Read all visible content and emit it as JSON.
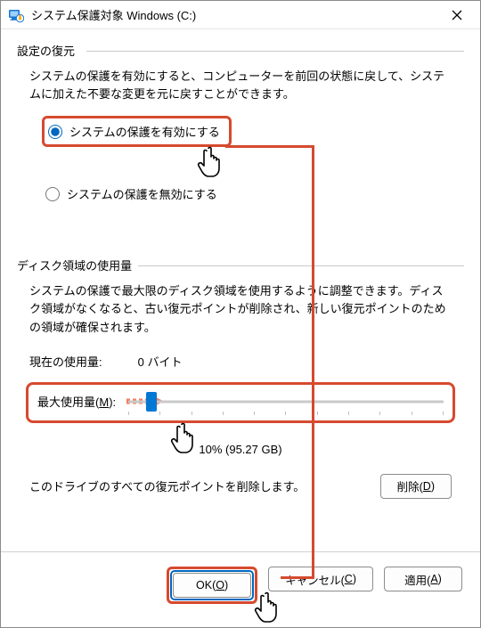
{
  "title": "システム保護対象 Windows (C:)",
  "restore": {
    "heading": "設定の復元",
    "desc": "システムの保護を有効にすると、コンピューターを前回の状態に戻して、システムに加えた不要な変更を元に戻すことができます。",
    "radios": {
      "enable": "システムの保護を有効にする",
      "disable": "システムの保護を無効にする"
    }
  },
  "disk": {
    "heading": "ディスク領域の使用量",
    "desc": "システムの保護で最大限のディスク領域を使用するように調整できます。ディスク領域がなくなると、古い復元ポイントが削除され、新しい復元ポイントのための領域が確保されます。",
    "current_label": "現在の使用量:",
    "current_value": "0 バイト",
    "max_label_pre": "最大使用量(",
    "max_label_u": "M",
    "max_label_post": "):",
    "slider_value": "10% (95.27 GB)"
  },
  "delete_desc": "このドライブのすべての復元ポイントを削除します。",
  "buttons": {
    "delete_pre": "削除(",
    "delete_u": "D",
    "delete_post": ")",
    "ok_pre": "OK(",
    "ok_u": "O",
    "ok_post": ")",
    "cancel_pre": "キャンセル(",
    "cancel_u": "C",
    "cancel_post": ")",
    "apply_pre": "適用(",
    "apply_u": "A",
    "apply_post": ")"
  }
}
